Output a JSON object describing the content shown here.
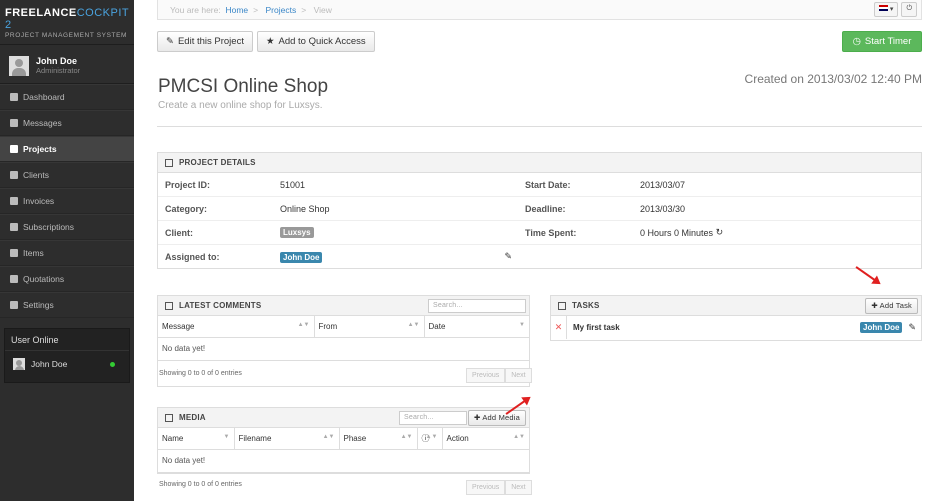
{
  "app": {
    "brand_a": "FREELANCE",
    "brand_b": "COCKPIT 2",
    "tagline": "PROJECT MANAGEMENT SYSTEM"
  },
  "user": {
    "name": "John Doe",
    "role": "Administrator"
  },
  "nav": [
    {
      "label": "Dashboard",
      "icon": "grid-icon"
    },
    {
      "label": "Messages",
      "icon": "inbox-icon"
    },
    {
      "label": "Projects",
      "icon": "briefcase-icon",
      "active": true
    },
    {
      "label": "Clients",
      "icon": "user-icon"
    },
    {
      "label": "Invoices",
      "icon": "invoice-icon"
    },
    {
      "label": "Subscriptions",
      "icon": "subscription-icon"
    },
    {
      "label": "Items",
      "icon": "file-icon"
    },
    {
      "label": "Quotations",
      "icon": "quotation-icon"
    },
    {
      "label": "Settings",
      "icon": "gear-icon"
    }
  ],
  "online": {
    "title": "User Online",
    "user": "John Doe"
  },
  "breadcrumb": {
    "prefix": "You are here:",
    "home": "Home",
    "projects": "Projects",
    "current": "View"
  },
  "actions": {
    "edit": "Edit this Project",
    "quick": "Add to Quick Access",
    "timer": "Start Timer"
  },
  "project": {
    "title": "PMCSI Online Shop",
    "subtitle": "Create a new online shop for Luxsys.",
    "created": "Created on 2013/03/02 12:40 PM"
  },
  "details": {
    "header": "PROJECT DETAILS",
    "id_label": "Project ID:",
    "id": "51001",
    "category_label": "Category:",
    "category": "Online Shop",
    "client_label": "Client:",
    "client": "Luxsys",
    "assigned_label": "Assigned to:",
    "assigned": "John Doe",
    "start_label": "Start Date:",
    "start": "2013/03/07",
    "deadline_label": "Deadline:",
    "deadline": "2013/03/30",
    "spent_label": "Time Spent:",
    "spent": "0 Hours 0 Minutes"
  },
  "comments": {
    "header": "LATEST COMMENTS",
    "search": "Search...",
    "cols": [
      "Message",
      "From",
      "Date"
    ],
    "empty": "No data yet!",
    "info": "Showing 0 to 0 of 0 entries",
    "prev": "Previous",
    "next": "Next"
  },
  "tasks": {
    "header": "TASKS",
    "add": "Add Task",
    "item": "My first task",
    "assignee": "John Doe"
  },
  "media": {
    "header": "MEDIA",
    "search": "Search...",
    "add": "Add Media",
    "cols": [
      "Name",
      "Filename",
      "Phase",
      "Action"
    ],
    "empty": "No data yet!",
    "info": "Showing 0 to 0 of 0 entries",
    "prev": "Previous",
    "next": "Next"
  },
  "colors": {
    "accent": "#3a87c8",
    "success": "#5cb85c",
    "sidebar": "#2d2d2d",
    "arrow": "#e02020"
  }
}
